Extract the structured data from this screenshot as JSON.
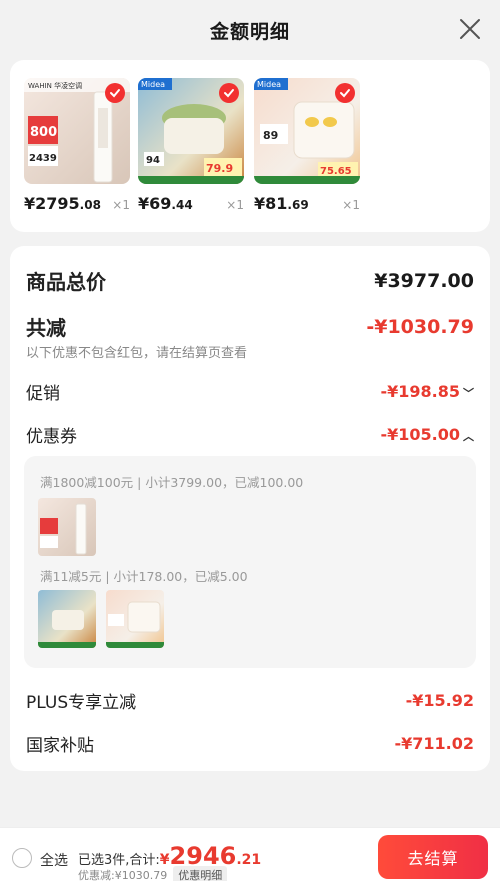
{
  "header": {
    "title": "金额明细"
  },
  "products": [
    {
      "price_int": "¥2795",
      "price_dec": ".08",
      "qty": "×1",
      "thumb_labels": {
        "brand": "WAHIN 华凌空调",
        "big": "800",
        "price": "2439"
      }
    },
    {
      "price_int": "¥69",
      "price_dec": ".44",
      "qty": "×1",
      "thumb_labels": {
        "brand": "Midea",
        "big": "94",
        "price": "79.9"
      }
    },
    {
      "price_int": "¥81",
      "price_dec": ".69",
      "qty": "×1",
      "thumb_labels": {
        "brand": "Midea",
        "big": "89",
        "price": "75.65"
      }
    }
  ],
  "summary": {
    "goods_total_label": "商品总价",
    "goods_total_value": "¥3977.00",
    "total_discount_label": "共减",
    "total_discount_value": "-¥1030.79",
    "hint": "以下优惠不包含红包，请在结算页查看",
    "promo_label": "促销",
    "promo_value": "-¥198.85",
    "coupon_label": "优惠券",
    "coupon_value": "-¥105.00",
    "plus_label": "PLUS专享立减",
    "plus_value": "-¥15.92",
    "subsidy_label": "国家补贴",
    "subsidy_value": "-¥711.02"
  },
  "coupon_groups": [
    {
      "title": "满1800减100元 | 小计3799.00，已减100.00"
    },
    {
      "title": "满11减5元 | 小计178.00，已减5.00"
    }
  ],
  "bottom": {
    "select_all": "全选",
    "selected_text": "已选3件,合计:",
    "currency": "¥",
    "total_int": "2946",
    "total_dec": ".21",
    "discount_text": "优惠减:¥1030.79",
    "detail_chip": "优惠明细",
    "checkout": "去结算"
  },
  "colors": {
    "accent": "#e83a2f",
    "checkout_gradient_start": "#ff4b3a",
    "checkout_gradient_end": "#f02f45"
  }
}
